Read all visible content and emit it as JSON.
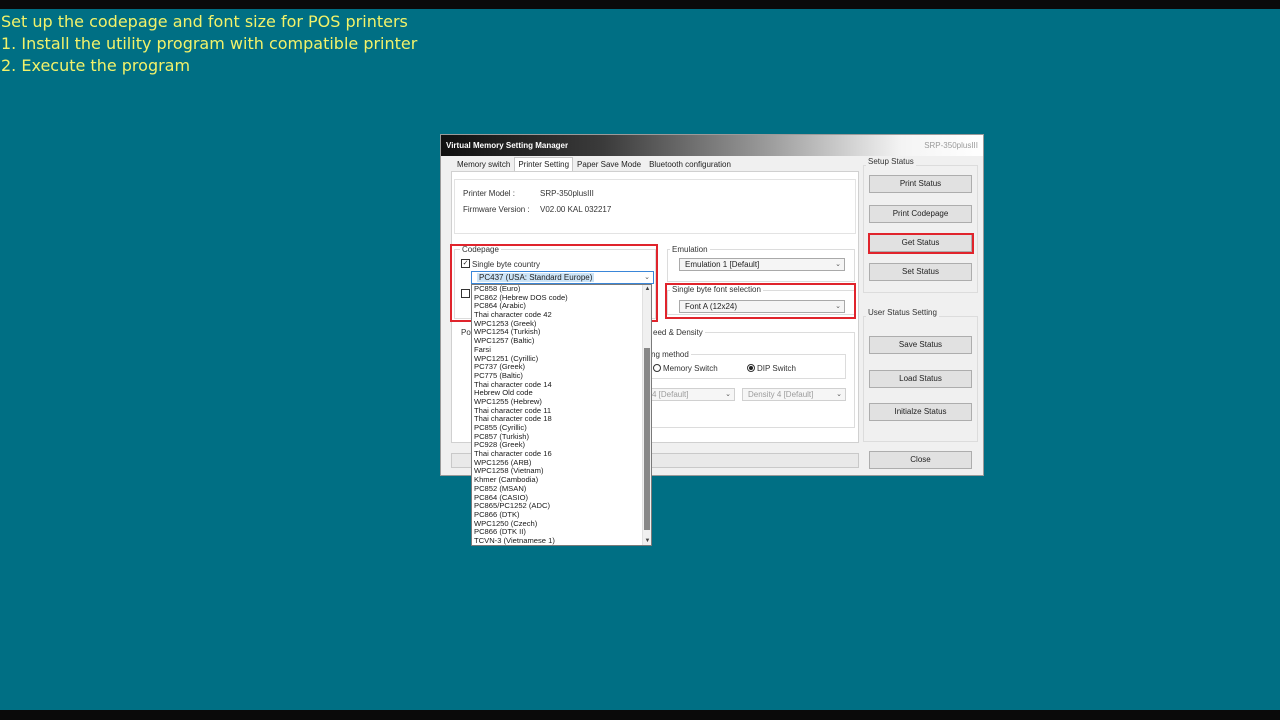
{
  "caption": {
    "line1": "Set up the codepage and font size for POS printers",
    "line2": "1. Install the utility program with compatible printer",
    "line3": "2. Execute the program"
  },
  "window": {
    "title": "Virtual Memory Setting Manager",
    "model_badge": "SRP-350plusIII"
  },
  "tabs": [
    "Memory switch",
    "Printer Setting",
    "Paper Save Mode",
    "Bluetooth configuration"
  ],
  "info": {
    "printer_model_label": "Printer Model :",
    "printer_model_value": "SRP-350plusIII",
    "firmware_label": "Firmware Version :",
    "firmware_value": "V02.00 KAL 032217"
  },
  "codepage": {
    "group_title": "Codepage",
    "single_byte_label": "Single byte country",
    "single_byte_checked": true,
    "selected": "PC437 (USA: Standard Europe)",
    "options": [
      "PC858 (Euro)",
      "PC862 (Hebrew DOS code)",
      "PC864 (Arabic)",
      "Thai character code 42",
      "WPC1253 (Greek)",
      "WPC1254 (Turkish)",
      "WPC1257 (Baltic)",
      "Farsi",
      "WPC1251 (Cyrillic)",
      "PC737 (Greek)",
      "PC775 (Baltic)",
      "Thai character code 14",
      "Hebrew Old code",
      "WPC1255 (Hebrew)",
      "Thai character code 11",
      "Thai character code 18",
      "PC855 (Cyrillic)",
      "PC857 (Turkish)",
      "PC928 (Greek)",
      "Thai character code 16",
      "WPC1256 (ARB)",
      "WPC1258 (Vietnam)",
      "Khmer (Cambodia)",
      "PC852 (MSAN)",
      "PC864 (CASIO)",
      "PC865/PC1252 (ADC)",
      "PC866 (DTK)",
      "WPC1250 (Czech)",
      "PC866 (DTK II)",
      "TCVN-3 (Vietnamese 1)"
    ]
  },
  "emulation": {
    "group_title": "Emulation",
    "value": "Emulation 1 [Default]"
  },
  "font": {
    "group_title": "Single byte font selection",
    "value": "Font A (12x24)"
  },
  "speed": {
    "group_title_partial": "eed & Density",
    "method_partial": "ng method",
    "memory_switch": "Memory Switch",
    "dip_switch": "DIP Switch",
    "dip_selected": true,
    "speed_value_partial": "4 [Default]",
    "density_value": "Density 4 [Default]"
  },
  "partial_labels": {
    "po": "Po"
  },
  "setup_status": {
    "title": "Setup Status",
    "print_status": "Print Status",
    "print_codepage": "Print Codepage",
    "get_status": "Get Status",
    "set_status": "Set Status"
  },
  "user_status": {
    "title": "User Status Setting",
    "save_status": "Save Status",
    "load_status": "Load Status",
    "initialize_status": "Initialze Status"
  },
  "close_label": "Close",
  "colors": {
    "background": "#006f84",
    "caption": "#f2f26a",
    "highlight": "#e0242c"
  }
}
